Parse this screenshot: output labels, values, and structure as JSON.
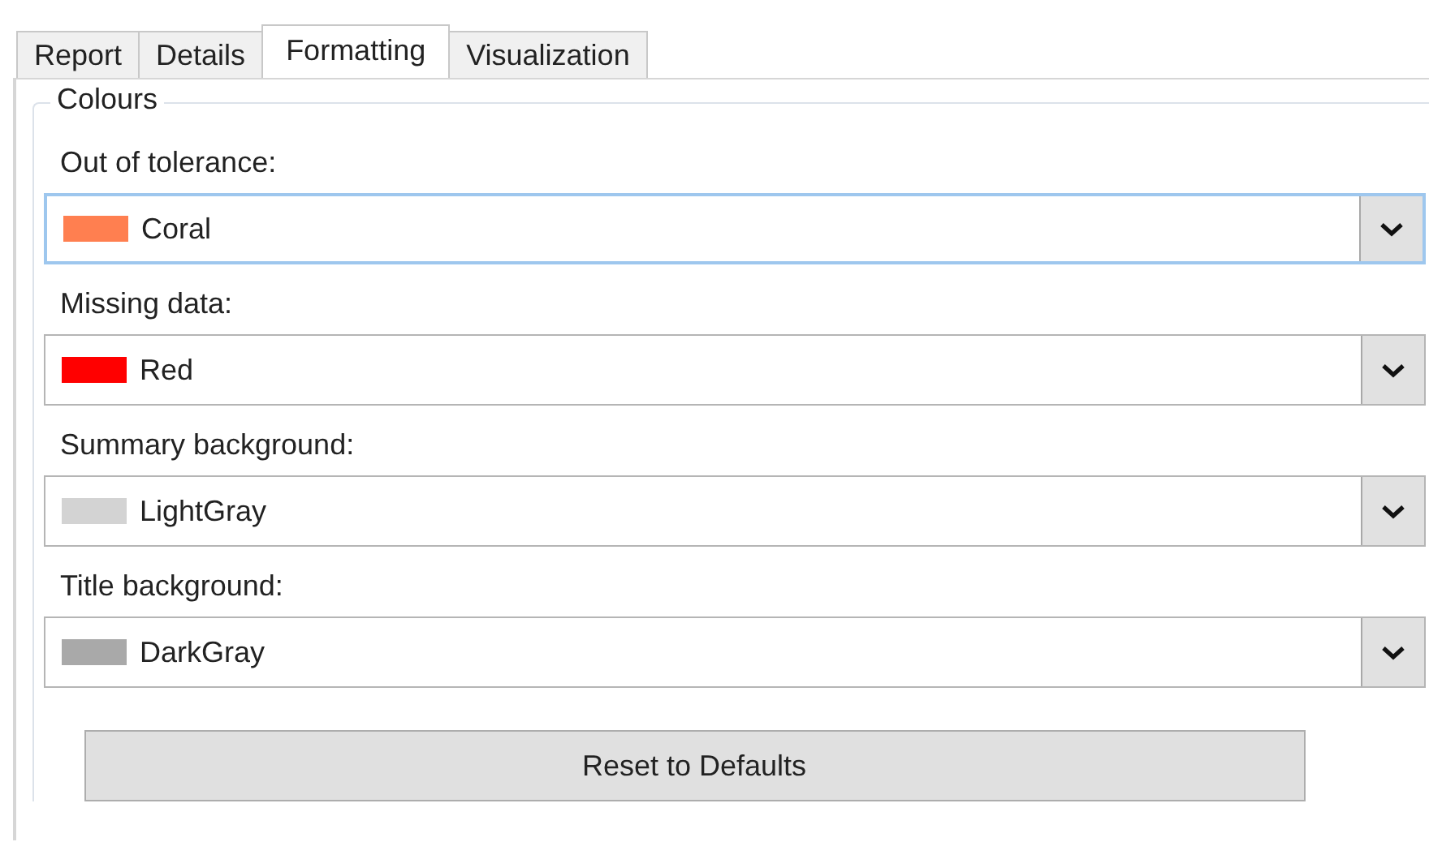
{
  "tabs": [
    {
      "label": "Report",
      "selected": false
    },
    {
      "label": "Details",
      "selected": false
    },
    {
      "label": "Formatting",
      "selected": true
    },
    {
      "label": "Visualization",
      "selected": false
    }
  ],
  "group": {
    "title": "Colours",
    "fields": [
      {
        "label": "Out of tolerance:",
        "value": "Coral",
        "color": "#ff7f50",
        "focused": true
      },
      {
        "label": "Missing data:",
        "value": "Red",
        "color": "#ff0000",
        "focused": false
      },
      {
        "label": "Summary background:",
        "value": "LightGray",
        "color": "#d3d3d3",
        "focused": false
      },
      {
        "label": "Title background:",
        "value": "DarkGray",
        "color": "#a9a9a9",
        "focused": false
      }
    ]
  },
  "reset_button": "Reset to Defaults"
}
